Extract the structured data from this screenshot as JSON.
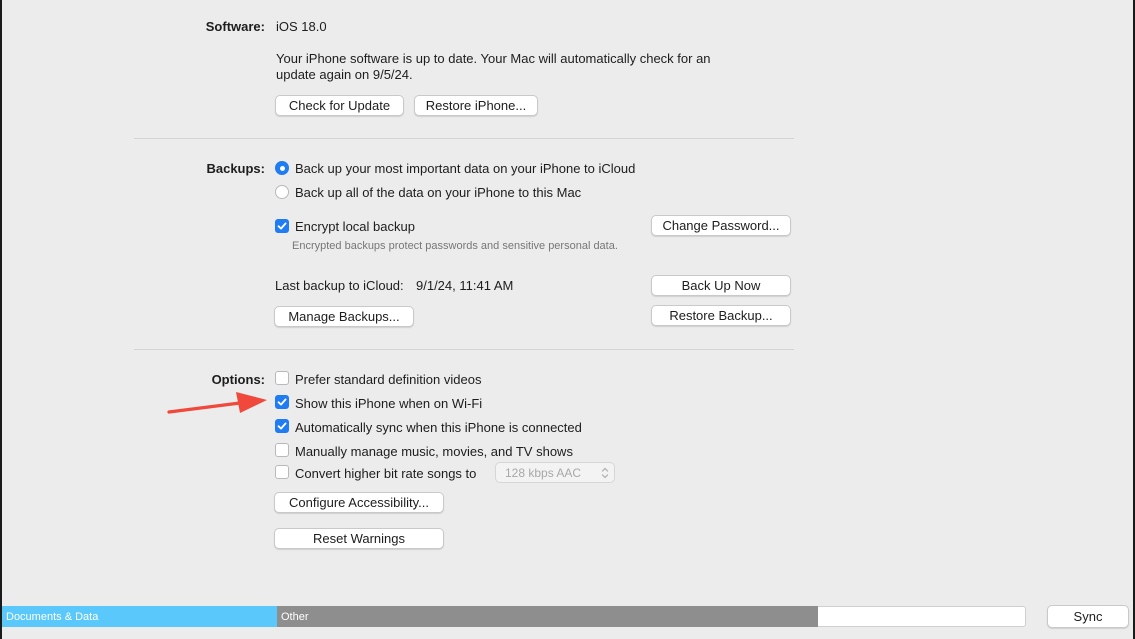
{
  "software": {
    "label": "Software:",
    "version": "iOS 18.0",
    "status_line1": "Your iPhone software is up to date. Your Mac will automatically check for an",
    "status_line2": "update again on 9/5/24.",
    "check_button": "Check for Update",
    "restore_button": "Restore iPhone..."
  },
  "backups": {
    "label": "Backups:",
    "radio_icloud": "Back up your most important data on your iPhone to iCloud",
    "radio_mac": "Back up all of the data on your iPhone to this Mac",
    "radio_selected": "icloud",
    "encrypt_label": "Encrypt local backup",
    "encrypt_checked": true,
    "encrypt_hint": "Encrypted backups protect passwords and sensitive personal data.",
    "change_password_button": "Change Password...",
    "last_backup_label": "Last backup to iCloud:",
    "last_backup_value": "9/1/24, 11:41 AM",
    "back_up_now_button": "Back Up Now",
    "manage_button": "Manage Backups...",
    "restore_backup_button": "Restore Backup..."
  },
  "options": {
    "label": "Options:",
    "items": [
      {
        "label": "Prefer standard definition videos",
        "checked": false
      },
      {
        "label": "Show this iPhone when on Wi-Fi",
        "checked": true
      },
      {
        "label": "Automatically sync when this iPhone is connected",
        "checked": true
      },
      {
        "label": "Manually manage music, movies, and TV shows",
        "checked": false
      },
      {
        "label": "Convert higher bit rate songs to",
        "checked": false
      }
    ],
    "bitrate_select": "128 kbps AAC",
    "accessibility_button": "Configure Accessibility...",
    "reset_warnings_button": "Reset Warnings"
  },
  "storage": {
    "documents_label": "Documents & Data",
    "other_label": "Other",
    "colors": {
      "documents": "#5ac8fa",
      "other": "#8e8e8e",
      "free": "#ffffff"
    }
  },
  "sync_button": "Sync",
  "annotation": {
    "arrow_color": "#f0483b"
  }
}
